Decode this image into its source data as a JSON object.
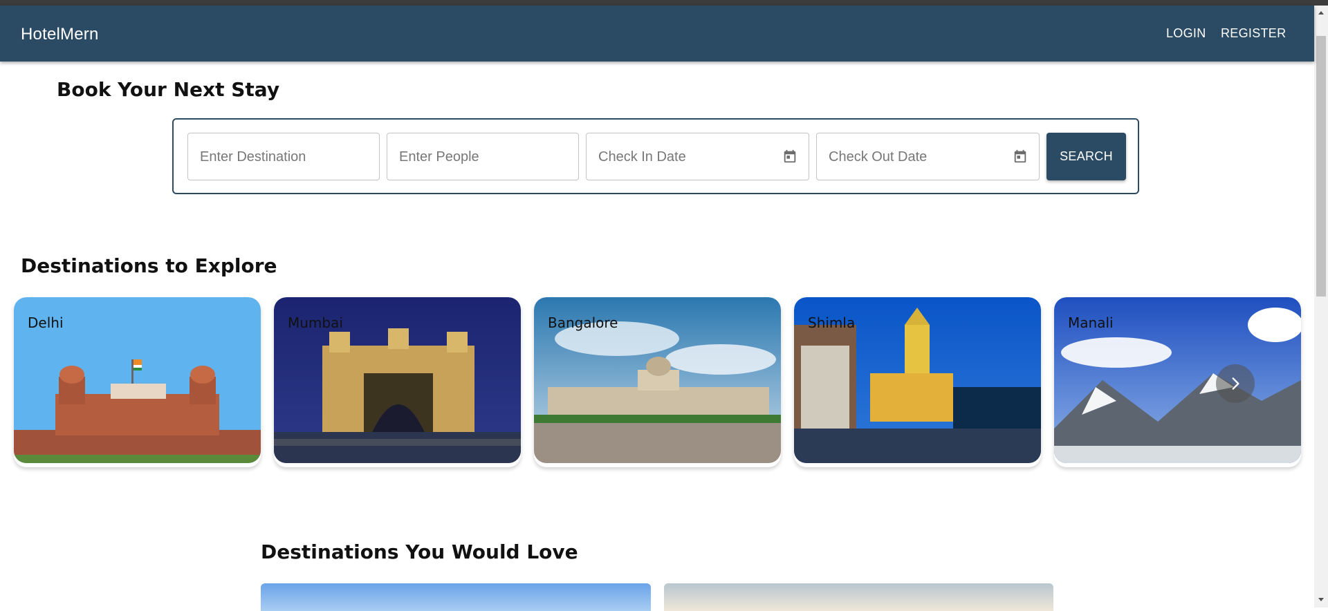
{
  "app": {
    "brand": "HotelMern"
  },
  "nav": {
    "login": "LOGIN",
    "register": "REGISTER"
  },
  "search": {
    "title": "Book Your Next Stay",
    "destination_placeholder": "Enter Destination",
    "people_placeholder": "Enter People",
    "checkin_placeholder": "Check In Date",
    "checkout_placeholder": "Check Out Date",
    "search_label": "SEARCH",
    "calendar_icon": "calendar-icon"
  },
  "explore": {
    "title": "Destinations to Explore",
    "cards": [
      {
        "name": "Delhi"
      },
      {
        "name": "Mumbai"
      },
      {
        "name": "Bangalore"
      },
      {
        "name": "Shimla"
      },
      {
        "name": "Manali"
      }
    ],
    "next_icon": "chevron-right-icon"
  },
  "love": {
    "title": "Destinations You Would Love"
  },
  "colors": {
    "primary": "#2b4a63",
    "background": "#ffffff"
  }
}
